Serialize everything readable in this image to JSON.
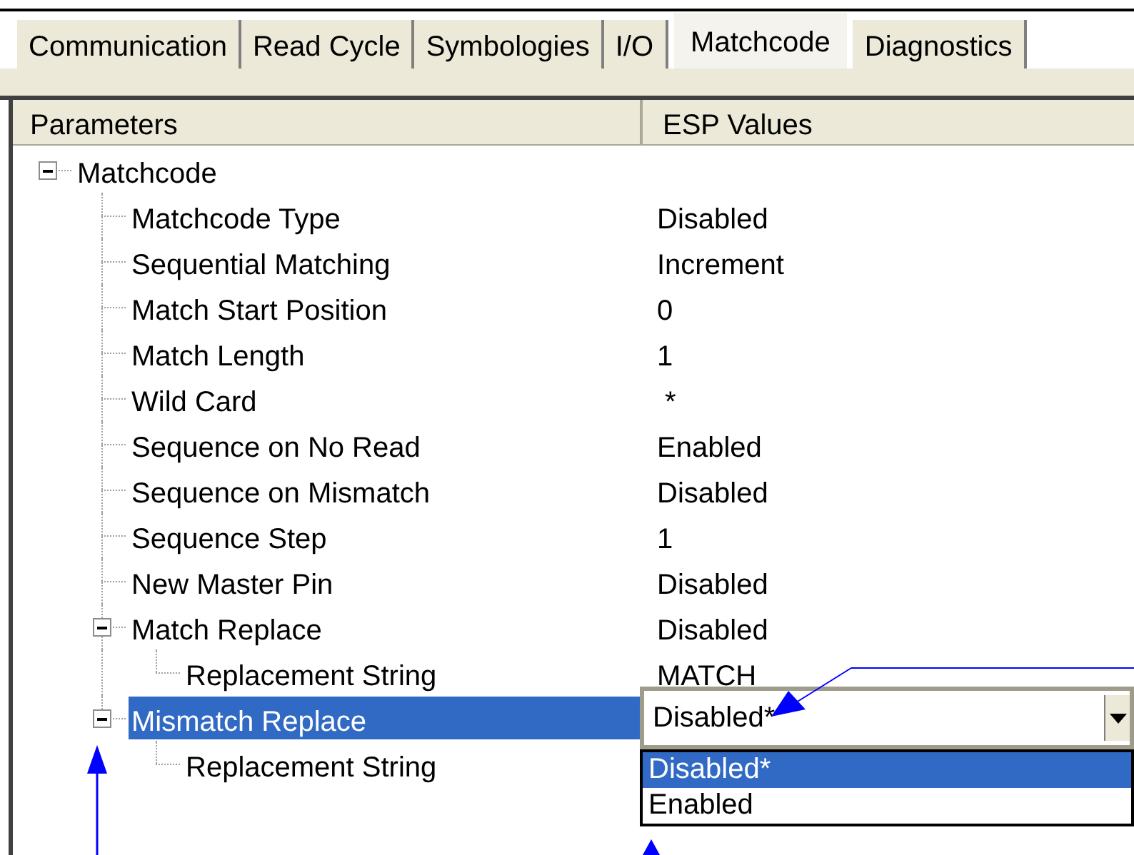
{
  "tabs": [
    {
      "label": "Communication",
      "selected": false
    },
    {
      "label": "Read Cycle",
      "selected": false
    },
    {
      "label": "Symbologies",
      "selected": false
    },
    {
      "label": "I/O",
      "selected": false
    },
    {
      "label": "Matchcode",
      "selected": true
    },
    {
      "label": "Diagnostics",
      "selected": false
    }
  ],
  "columns": [
    "Parameters",
    "ESP Values"
  ],
  "tree": [
    {
      "label": "Matchcode",
      "expanded": true,
      "selected": false,
      "children": [
        {
          "label": "Matchcode Type",
          "value": "Disabled",
          "selected": false
        },
        {
          "label": "Sequential Matching",
          "value": "Increment",
          "selected": false
        },
        {
          "label": "Match Start Position",
          "value": "0",
          "selected": false
        },
        {
          "label": "Match Length",
          "value": "1",
          "selected": false
        },
        {
          "label": "Wild Card",
          "value": " *",
          "selected": false
        },
        {
          "label": "Sequence on No Read",
          "value": "Enabled",
          "selected": false
        },
        {
          "label": "Sequence on Mismatch",
          "value": "Disabled",
          "selected": false
        },
        {
          "label": "Sequence Step",
          "value": "1",
          "selected": false
        },
        {
          "label": "New Master Pin",
          "value": "Disabled",
          "selected": false
        },
        {
          "label": "Match Replace",
          "value": "Disabled",
          "expanded": true,
          "selected": false,
          "children": [
            {
              "label": "Replacement String",
              "value": "MATCH",
              "selected": false
            }
          ]
        },
        {
          "label": "Mismatch Replace",
          "expanded": true,
          "selected": true,
          "dropdown": {
            "value": "Disabled*",
            "open": true,
            "options": [
              {
                "label": "Disabled*",
                "selected": true
              },
              {
                "label": "Enabled",
                "selected": false
              }
            ]
          },
          "children": [
            {
              "label": "Replacement String",
              "selected": false
            }
          ]
        }
      ]
    }
  ]
}
